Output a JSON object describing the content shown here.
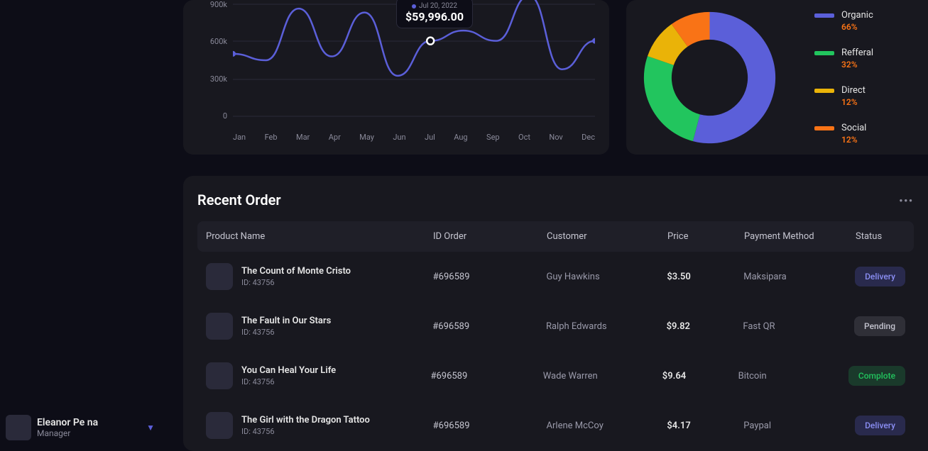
{
  "user": {
    "name": "Eleanor Pe na",
    "role": "Manager"
  },
  "chart_data": [
    {
      "type": "line",
      "x": [
        "Jan",
        "Feb",
        "Mar",
        "Apr",
        "May",
        "Jun",
        "Jul",
        "Aug",
        "Sep",
        "Oct",
        "Nov",
        "Dec"
      ],
      "values": [
        500000,
        450000,
        850000,
        480000,
        820000,
        330000,
        600000,
        680000,
        600000,
        950000,
        380000,
        600000
      ],
      "ylim": [
        0,
        900000
      ],
      "yticks": [
        "900k",
        "600k",
        "300k",
        "0"
      ],
      "tooltip": {
        "date": "Jul 20, 2022",
        "value": "$59,996.00",
        "index": 6
      }
    },
    {
      "type": "donut",
      "series": [
        {
          "name": "Organic",
          "value": 66,
          "color": "#5b5fd9"
        },
        {
          "name": "Refferal",
          "value": 32,
          "color": "#22c55e"
        },
        {
          "name": "Direct",
          "value": 12,
          "color": "#eab308"
        },
        {
          "name": "Social",
          "value": 12,
          "color": "#f97316"
        }
      ],
      "legend": [
        {
          "label": "Organic",
          "pct": "66%",
          "color": "#5b5fd9"
        },
        {
          "label": "Refferal",
          "pct": "32%",
          "color": "#22c55e"
        },
        {
          "label": "Direct",
          "pct": "12%",
          "color": "#eab308"
        },
        {
          "label": "Social",
          "pct": "12%",
          "color": "#f97316"
        }
      ]
    }
  ],
  "table": {
    "title": "Recent Order",
    "columns": {
      "product": "Product Name",
      "order": "ID Order",
      "customer": "Customer",
      "price": "Price",
      "payment": "Payment Method",
      "status": "Status"
    },
    "rows": [
      {
        "name": "The Count of Monte Cristo",
        "pid": "ID: 43756",
        "order": "#696589",
        "customer": "Guy Hawkins",
        "price": "$3.50",
        "payment": "Maksipara",
        "status": "Delivery",
        "badge": "delivery"
      },
      {
        "name": "The Fault in Our Stars",
        "pid": "ID: 43756",
        "order": "#696589",
        "customer": "Ralph Edwards",
        "price": "$9.82",
        "payment": "Fast QR",
        "status": "Pending",
        "badge": "pending"
      },
      {
        "name": "You Can Heal Your Life",
        "pid": "ID: 43756",
        "order": "#696589",
        "customer": "Wade Warren",
        "price": "$9.64",
        "payment": "Bitcoin",
        "status": "Complote",
        "badge": "complete"
      },
      {
        "name": "The Girl with the Dragon Tattoo",
        "pid": "ID: 43756",
        "order": "#696589",
        "customer": "Arlene McCoy",
        "price": "$4.17",
        "payment": "Paypal",
        "status": "Delivery",
        "badge": "delivery"
      }
    ]
  }
}
